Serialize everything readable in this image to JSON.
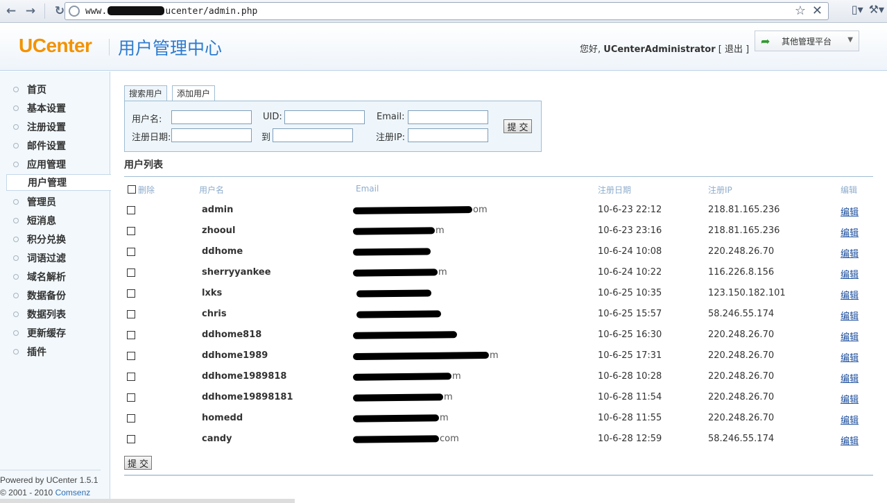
{
  "browser": {
    "url_prefix": "www.",
    "url_suffix": "ucenter/admin.php"
  },
  "header": {
    "logo": "UCenter",
    "title": "用户管理中心",
    "greeting_prefix": "您好, ",
    "username": "UCenterAdministrator",
    "logout_label": "[ 退出 ]",
    "platform_label": "其他管理平台"
  },
  "sidebar": {
    "items": [
      {
        "label": "首页"
      },
      {
        "label": "基本设置"
      },
      {
        "label": "注册设置"
      },
      {
        "label": "邮件设置"
      },
      {
        "label": "应用管理"
      },
      {
        "label": "用户管理",
        "active": true
      },
      {
        "label": "管理员"
      },
      {
        "label": "短消息"
      },
      {
        "label": "积分兑换"
      },
      {
        "label": "词语过滤"
      },
      {
        "label": "域名解析"
      },
      {
        "label": "数据备份"
      },
      {
        "label": "数据列表"
      },
      {
        "label": "更新缓存"
      },
      {
        "label": "插件"
      }
    ],
    "powered": "Powered by UCenter 1.5.1",
    "copyright": "© 2001 - 2010 ",
    "company": "Comsenz"
  },
  "tabs": {
    "search": "搜索用户",
    "add": "添加用户"
  },
  "search_form": {
    "username_label": "用户名:",
    "uid_label": "UID:",
    "email_label": "Email:",
    "regdate_label": "注册日期:",
    "to_label": "到",
    "regip_label": "注册IP:",
    "submit_label": "提交",
    "username_value": "",
    "uid_value": "",
    "email_value": "",
    "regdate_from_value": "",
    "regdate_to_value": "",
    "regip_value": ""
  },
  "user_list": {
    "title": "用户列表",
    "columns": {
      "delete": "删除",
      "username": "用户名",
      "email": "Email",
      "regdate": "注册日期",
      "regip": "注册IP",
      "edit": "编辑"
    },
    "rows": [
      {
        "username": "admin",
        "email_visible": "om",
        "regdate": "10-6-23 22:12",
        "regip": "218.81.165.236",
        "edit": "编辑"
      },
      {
        "username": "zhooul",
        "email_visible": "m",
        "regdate": "10-6-23 23:16",
        "regip": "218.81.165.236",
        "edit": "编辑"
      },
      {
        "username": "ddhome",
        "email_visible": "",
        "regdate": "10-6-24 10:08",
        "regip": "220.248.26.70",
        "edit": "编辑"
      },
      {
        "username": "sherryyankee",
        "email_visible": "m",
        "regdate": "10-6-24 10:22",
        "regip": "116.226.8.156",
        "edit": "编辑"
      },
      {
        "username": "lxks",
        "email_visible": "",
        "regdate": "10-6-25 10:35",
        "regip": "123.150.182.101",
        "edit": "编辑"
      },
      {
        "username": "chris",
        "email_visible": "",
        "regdate": "10-6-25 15:57",
        "regip": "58.246.55.174",
        "edit": "编辑"
      },
      {
        "username": "ddhome818",
        "email_visible": "",
        "regdate": "10-6-25 16:30",
        "regip": "220.248.26.70",
        "edit": "编辑"
      },
      {
        "username": "ddhome1989",
        "email_visible": "m",
        "regdate": "10-6-25 17:31",
        "regip": "220.248.26.70",
        "edit": "编辑"
      },
      {
        "username": "ddhome1989818",
        "email_visible": "m",
        "regdate": "10-6-28 10:28",
        "regip": "220.248.26.70",
        "edit": "编辑"
      },
      {
        "username": "ddhome19898181",
        "email_visible": "m",
        "regdate": "10-6-28 11:54",
        "regip": "220.248.26.70",
        "edit": "编辑"
      },
      {
        "username": "homedd",
        "email_visible": "m",
        "regdate": "10-6-28 11:55",
        "regip": "220.248.26.70",
        "edit": "编辑"
      },
      {
        "username": "candy",
        "email_visible": "com",
        "regdate": "10-6-28 12:59",
        "regip": "58.246.55.174",
        "edit": "编辑"
      }
    ],
    "submit_label": "提交"
  },
  "colors": {
    "logo_orange": "#f39200",
    "title_blue": "#2e7bcf",
    "panel_bg": "#eef6fb",
    "border_blue": "#9fbcd3",
    "link_blue": "#1d4f9e"
  }
}
